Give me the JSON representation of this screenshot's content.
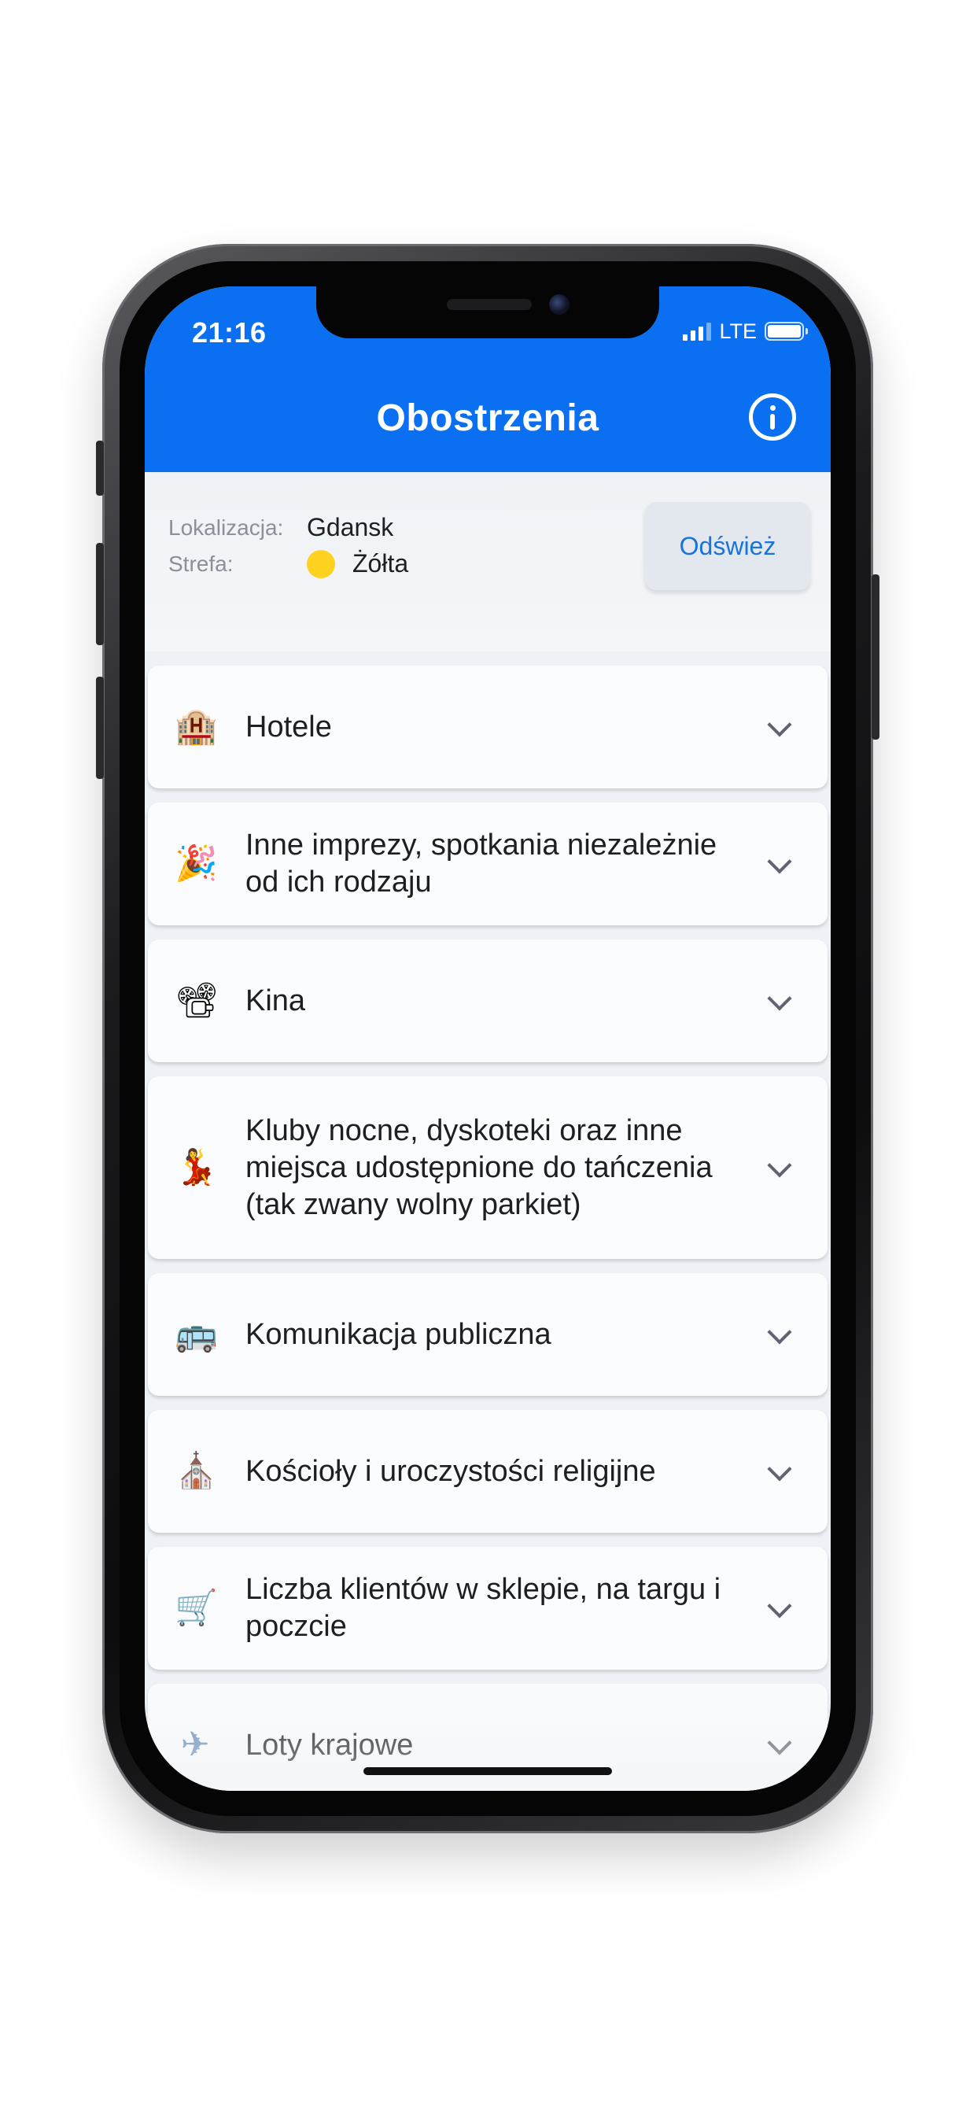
{
  "status_bar": {
    "time": "21:16",
    "network": "LTE",
    "signal_bars": 3,
    "signal_bars_max": 4,
    "battery_level": 1.0
  },
  "header": {
    "title": "Obostrzenia",
    "info_icon": "info-circle-icon",
    "background_color": "#0a6ff0"
  },
  "location": {
    "location_label": "Lokalizacja:",
    "location_value": "Gdansk",
    "zone_label": "Strefa:",
    "zone_value": "Żółta",
    "zone_color": "#ffd21f",
    "refresh_label": "Odśwież"
  },
  "categories": [
    {
      "icon": "hotel-icon",
      "emoji": "🏨",
      "label": "Hotele"
    },
    {
      "icon": "party-popper-icon",
      "emoji": "🎉",
      "label": "Inne imprezy, spotkania niezależnie od ich rodzaju"
    },
    {
      "icon": "film-projector-icon",
      "emoji": "📽",
      "label": "Kina"
    },
    {
      "icon": "dancer-icon",
      "emoji": "💃",
      "label": "Kluby nocne, dyskoteki oraz inne miejsca udostępnione do tańczenia (tak zwany wolny parkiet)"
    },
    {
      "icon": "bus-icon",
      "emoji": "🚌",
      "label": "Komunikacja publiczna"
    },
    {
      "icon": "church-icon",
      "emoji": "⛪",
      "label": "Kościoły i uroczystości religijne"
    },
    {
      "icon": "shopping-cart-icon",
      "emoji": "🛒",
      "label": "Liczba klientów w sklepie, na targu i poczcie"
    },
    {
      "icon": "airplane-icon",
      "emoji": "✈",
      "label": "Loty krajowe"
    }
  ]
}
